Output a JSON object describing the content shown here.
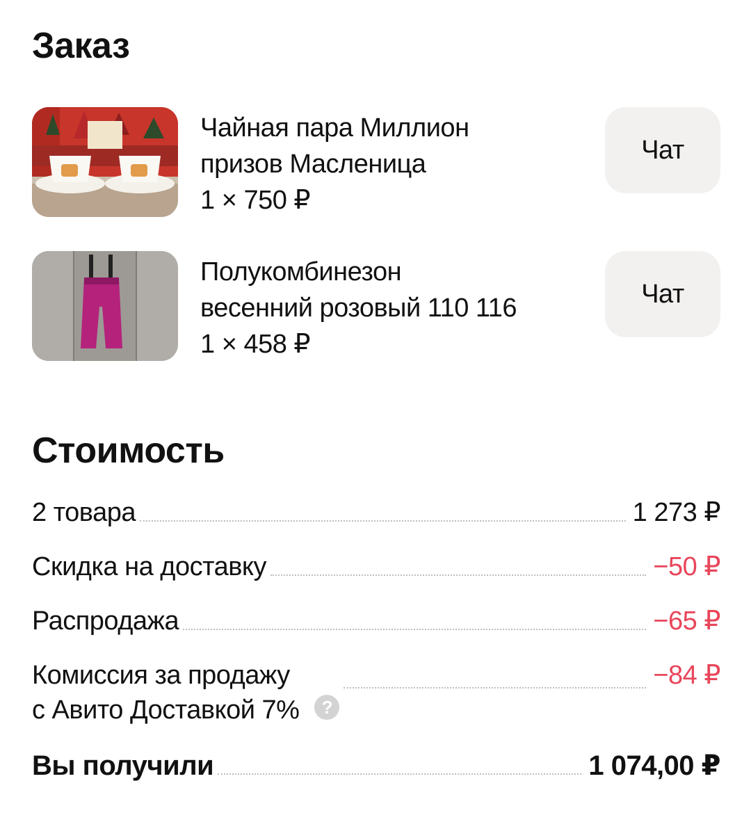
{
  "order": {
    "title": "Заказ",
    "products": [
      {
        "line1": "Чайная пара Миллион",
        "line2": "призов Масленица",
        "price": "1 × 750 ₽",
        "chat_label": "Чат"
      },
      {
        "line1": "Полукомбинезон",
        "line2": "весенний розовый 110 116",
        "price": "1 × 458 ₽",
        "chat_label": "Чат"
      }
    ]
  },
  "cost": {
    "title": "Стоимость",
    "rows": [
      {
        "label": "2 товара",
        "value": "1 273 ₽"
      },
      {
        "label": "Скидка на доставку",
        "value": "−50 ₽"
      },
      {
        "label": "Распродажа",
        "value": "−65 ₽"
      },
      {
        "label_line1": "Комиссия за продажу",
        "label_line2": "с Авито Доставкой 7%",
        "value": "−84 ₽",
        "help_icon": "?"
      }
    ],
    "total": {
      "label": "Вы получили",
      "value": "1 074,00 ₽"
    }
  },
  "colors": {
    "negative": "#e8465a",
    "chat_button_bg": "#f2f1f0"
  },
  "icons": {
    "help": "question-circle-icon"
  }
}
